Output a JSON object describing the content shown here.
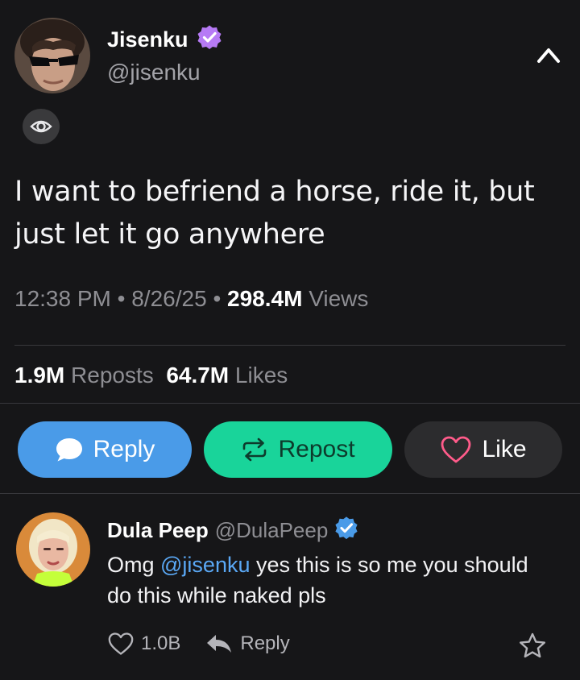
{
  "post": {
    "author_name": "Jisenku",
    "author_handle": "@jisenku",
    "text": "I want to befriend a horse, ride it, but just let it go anywhere",
    "time": "12:38 PM",
    "date": "8/26/25",
    "views_count": "298.4M",
    "views_label": "Views",
    "separator": "•",
    "reposts_count": "1.9M",
    "reposts_label": "Reposts",
    "likes_count": "64.7M",
    "likes_label": "Likes"
  },
  "actions": {
    "reply_label": "Reply",
    "repost_label": "Repost",
    "like_label": "Like"
  },
  "reply": {
    "author_name": "Dula Peep",
    "author_handle": "@DulaPeep",
    "text_before": "Omg ",
    "mention": "@jisenku",
    "text_after": " yes this is so me you should do this while naked pls",
    "like_count": "1.0B",
    "reply_label": "Reply"
  },
  "colors": {
    "background": "#161618",
    "reply_button": "#4a9be8",
    "repost_button": "#19d49a",
    "like_button": "#2c2c2e",
    "verified_purple": "#b67af5",
    "verified_blue": "#4a9be8",
    "mention": "#5aa8f5"
  },
  "icons": {
    "author_badge": "verified-badge-icon",
    "collapse": "chevron-up-icon",
    "views": "eye-icon",
    "reply": "speech-bubble-icon",
    "repost": "repost-arrows-icon",
    "like": "heart-icon",
    "reply_reply": "reply-arrow-icon",
    "bookmark": "star-icon"
  }
}
